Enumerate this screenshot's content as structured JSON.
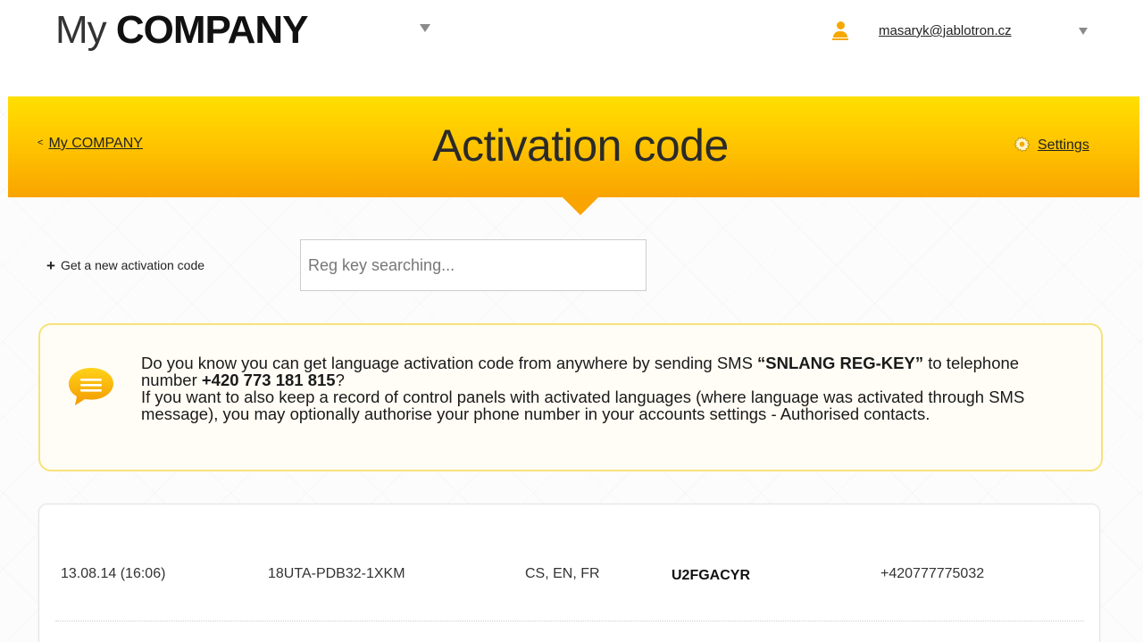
{
  "header": {
    "brand_light": "My",
    "brand_bold": "COMPANY",
    "user_email": "masaryk@jablotron.cz"
  },
  "band": {
    "back_link": "My COMPANY",
    "title": "Activation code",
    "settings": "Settings"
  },
  "toolbar": {
    "new_code_label": "Get a new activation code",
    "search_placeholder": "Reg key searching..."
  },
  "info": {
    "line1_pre": "Do you know you can get language activation code from anywhere by sending SMS ",
    "line1_bold": "“SNLANG REG-KEY”",
    "line1_mid": " to telephone number ",
    "phone": "+420 773 181 815",
    "line1_end": "?",
    "line2": "If you want to also keep a record of control panels with activated languages (where language was activated through SMS message), you may optionally authorise your phone number in your accounts settings  - Authorised contacts."
  },
  "table": {
    "rows": [
      {
        "date": "13.08.14 (16:06)",
        "reg_key": "18UTA-PDB32-1XKM",
        "languages": "CS, EN, FR",
        "code": "U2FGACYR",
        "phone": "+420777775032"
      }
    ]
  },
  "colors": {
    "band_top": "#ffdf00",
    "band_bottom": "#f9a400",
    "accent": "#f7a800",
    "info_border": "#f7e27c"
  },
  "icons": [
    "caret-down-icon",
    "user-icon",
    "gear-icon",
    "plus-icon",
    "chat-bubble-icon"
  ]
}
